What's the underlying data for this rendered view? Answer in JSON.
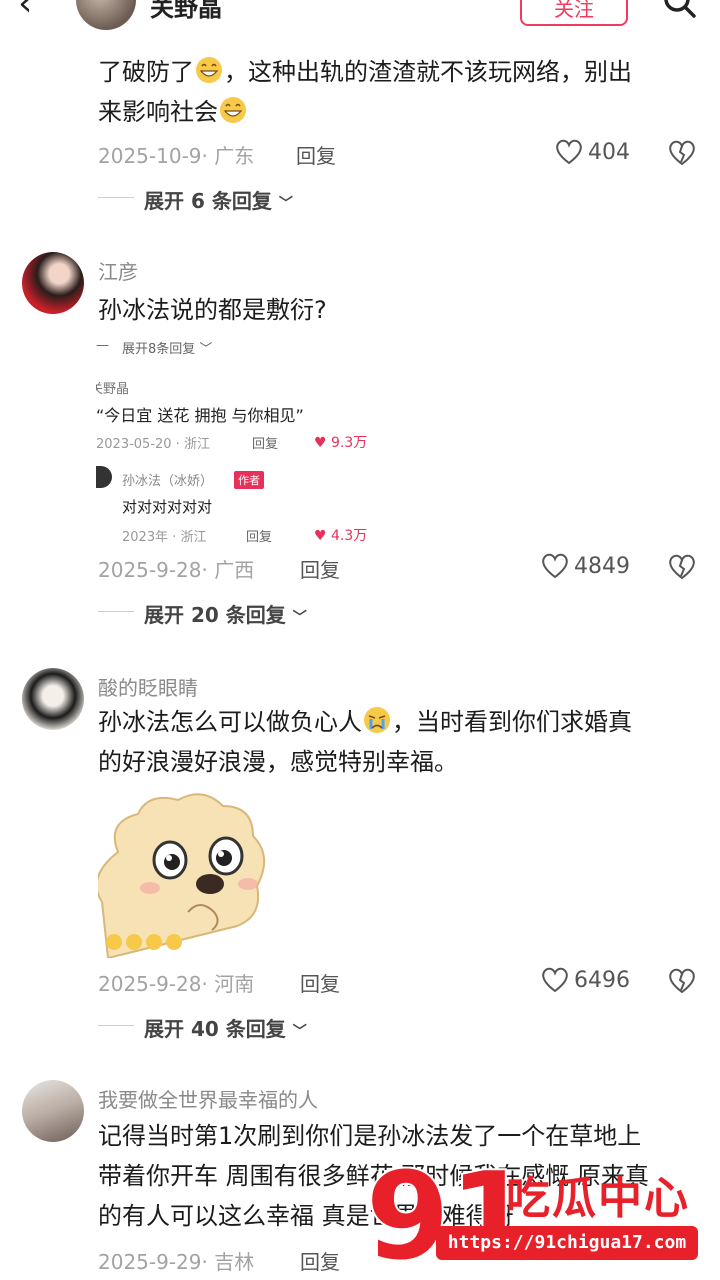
{
  "header": {
    "user_name": "关野晶",
    "follow_label": "关注"
  },
  "comments": [
    {
      "text_line1": "了破防了",
      "text_line1b": "，这种出轨的渣渣就不该玩网络，别出",
      "text_line2": "来影响社会",
      "meta": "2025-10-9· 广东",
      "reply": "回复",
      "likes": "404",
      "expand": "展开 6 条回复"
    },
    {
      "name": "江彦",
      "text": "孙冰法说的都是敷衍?",
      "meta": "2025-9-28· 广西",
      "reply": "回复",
      "likes": "4849",
      "expand": "展开 20 条回复",
      "screenshot": {
        "expand": "展开8条回复",
        "user": "关野晶",
        "quote": "“今日宜 送花 拥抱 与你相见”",
        "meta": "2023-05-20 · 浙江",
        "reply": "回复",
        "likes": "9.3万",
        "sub_name": "孙冰法（冰娇）",
        "author_tag": "作者",
        "sub_text": "对对对对对对",
        "sub_meta": "2023年 · 浙江",
        "sub_reply": "回复",
        "sub_likes": "4.3万"
      }
    },
    {
      "name": "酸的眨眼睛",
      "text_line1": "孙冰法怎么可以做负心人",
      "text_line1b": "，当时看到你们求婚真",
      "text_line2": "的好浪漫好浪漫，感觉特别幸福。",
      "meta": "2025-9-28· 河南",
      "reply": "回复",
      "likes": "6496",
      "expand": "展开 40 条回复"
    },
    {
      "name": "我要做全世界最幸福的人",
      "text_line1": "记得当时第1次刷到你们是孙冰法发了一个在草地上",
      "text_line2": "带着你开车 周围有很多鲜花 那时候我在感慨 原来真",
      "text_line3": "的有人可以这么幸福 真是世界上难得呀",
      "meta": "2025-9-29· 吉林",
      "reply": "回复"
    }
  ],
  "watermark": {
    "brand": "吃瓜中心",
    "number": "91",
    "url": "https://91chigua17.com"
  },
  "icons": [
    "back-icon",
    "search-icon",
    "heart-icon",
    "dislike-icon",
    "chevron-down-icon",
    "grin-emoji-icon",
    "cry-emoji-icon"
  ]
}
